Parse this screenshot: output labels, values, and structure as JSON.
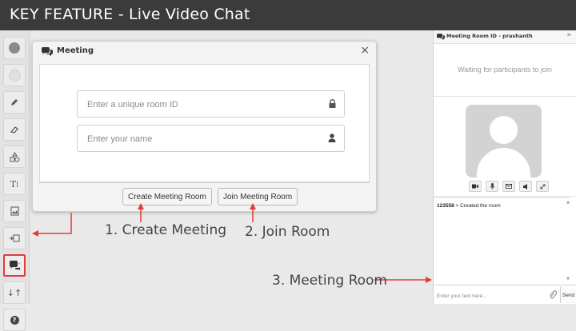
{
  "banner": {
    "title": "KEY FEATURE - Live Video Chat"
  },
  "toolbar": {
    "tools": [
      {
        "icon": "dark-circle-icon"
      },
      {
        "icon": "light-circle-icon"
      },
      {
        "icon": "pencil-icon"
      },
      {
        "icon": "eraser-icon"
      },
      {
        "icon": "shapes-icon"
      },
      {
        "label": "T⁞",
        "icon": "text-tool-icon"
      },
      {
        "icon": "image-icon"
      },
      {
        "icon": "embed-icon"
      },
      {
        "icon": "chat-icon",
        "active": true
      },
      {
        "label": "↓↑",
        "icon": "sort-icon"
      },
      {
        "label": "?",
        "icon": "help-icon"
      }
    ]
  },
  "dialog": {
    "title": "Meeting",
    "close_label": "×",
    "room_placeholder": "Enter a unique room ID",
    "name_placeholder": "Enter your name",
    "create_label": "Create Meeting Room",
    "join_label": "Join Meeting Room"
  },
  "annotations": {
    "create": "1. Create Meeting",
    "join": "2. Join Room",
    "room": "3. Meeting Room"
  },
  "panel": {
    "title": "Meeting Room ID - prashanth",
    "collapse_label": "»",
    "waiting": "Waiting for participants to join",
    "log_room": "123558",
    "log_text": " > Created the room",
    "chat_placeholder": "Enter your text here...",
    "send_label": "Send"
  },
  "colors": {
    "banner": "#3b3b3b",
    "accent_red": "#e53a3a"
  }
}
